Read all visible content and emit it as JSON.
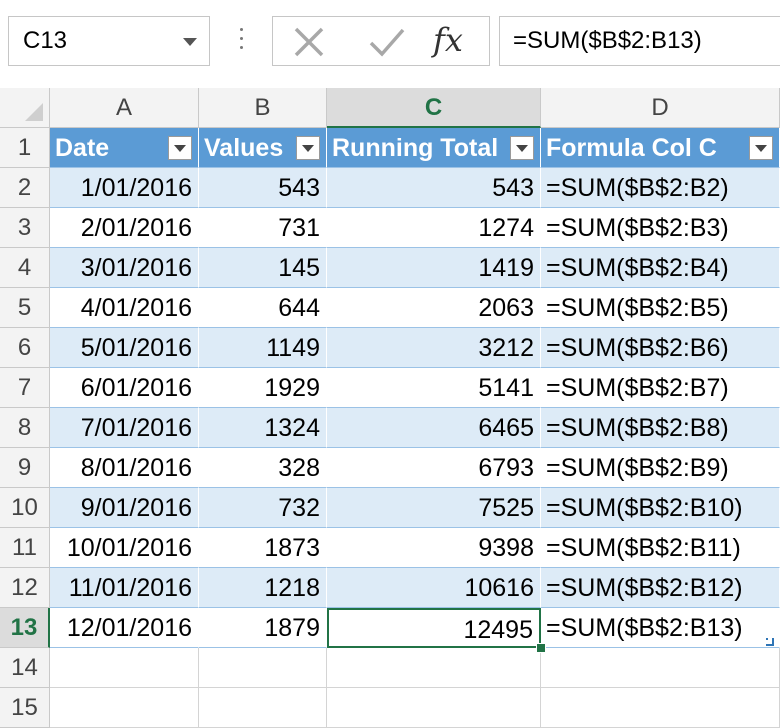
{
  "name_box": {
    "value": "C13"
  },
  "formula_bar": {
    "cancel_icon": "x-icon",
    "enter_icon": "checkmark-icon",
    "function_label": "fx",
    "value": "=SUM($B$2:B13)"
  },
  "column_headers": [
    "A",
    "B",
    "C",
    "D"
  ],
  "row_numbers": [
    "1",
    "2",
    "3",
    "4",
    "5",
    "6",
    "7",
    "8",
    "9",
    "10",
    "11",
    "12",
    "13",
    "14",
    "15"
  ],
  "selected": {
    "column": "C",
    "row": "13"
  },
  "table": {
    "headers": [
      "Date",
      "Values",
      "Running Total",
      "Formula Col C"
    ],
    "rows": [
      [
        "1/01/2016",
        "543",
        "543",
        "=SUM($B$2:B2)"
      ],
      [
        "2/01/2016",
        "731",
        "1274",
        "=SUM($B$2:B3)"
      ],
      [
        "3/01/2016",
        "145",
        "1419",
        "=SUM($B$2:B4)"
      ],
      [
        "4/01/2016",
        "644",
        "2063",
        "=SUM($B$2:B5)"
      ],
      [
        "5/01/2016",
        "1149",
        "3212",
        "=SUM($B$2:B6)"
      ],
      [
        "6/01/2016",
        "1929",
        "5141",
        "=SUM($B$2:B7)"
      ],
      [
        "7/01/2016",
        "1324",
        "6465",
        "=SUM($B$2:B8)"
      ],
      [
        "8/01/2016",
        "328",
        "6793",
        "=SUM($B$2:B9)"
      ],
      [
        "9/01/2016",
        "732",
        "7525",
        "=SUM($B$2:B10)"
      ],
      [
        "10/01/2016",
        "1873",
        "9398",
        "=SUM($B$2:B11)"
      ],
      [
        "11/01/2016",
        "1218",
        "10616",
        "=SUM($B$2:B12)"
      ],
      [
        "12/01/2016",
        "1879",
        "12495",
        "=SUM($B$2:B13)"
      ]
    ]
  },
  "colors": {
    "table_header": "#5b9bd5",
    "band_row": "#ddebf7",
    "selection": "#217346",
    "error_indicator": "#1e7a3c"
  }
}
